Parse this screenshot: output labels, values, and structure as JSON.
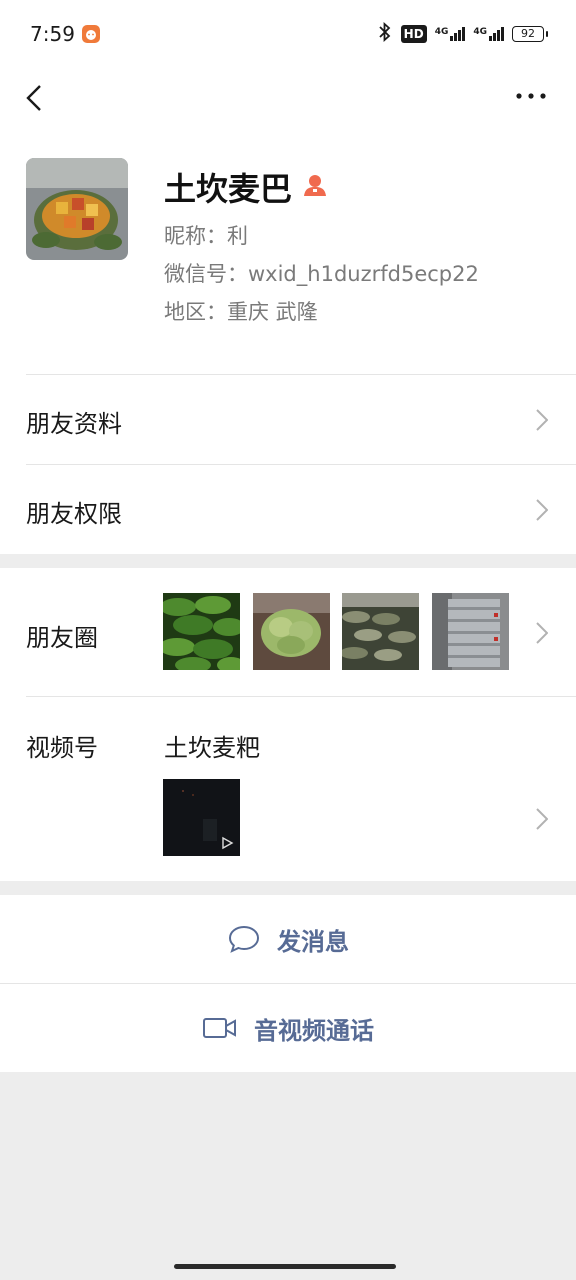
{
  "status_bar": {
    "time": "7:59",
    "hd": "HD",
    "net1": "4G",
    "net2": "4G",
    "battery": "92"
  },
  "profile": {
    "name": "土坎麦巴",
    "nickname": "昵称：利",
    "wechat_id": "微信号：wxid_h1duzrfd5ecp22",
    "region": "地区：重庆  武隆"
  },
  "list": {
    "friend_info": "朋友资料",
    "friend_permission": "朋友权限",
    "moments": "朋友圈",
    "channels": "视频号",
    "channels_name": "土坎麦粑"
  },
  "actions": {
    "message": "发消息",
    "call": "音视频通话"
  },
  "colors": {
    "link_blue": "#576b95",
    "background": "#ededed",
    "gender_icon": "#f06a4e"
  },
  "icons": [
    "back-arrow-icon",
    "more-icon",
    "female-icon",
    "chevron-right-icon",
    "chat-bubble-icon",
    "video-camera-icon",
    "play-icon",
    "bluetooth-icon"
  ]
}
